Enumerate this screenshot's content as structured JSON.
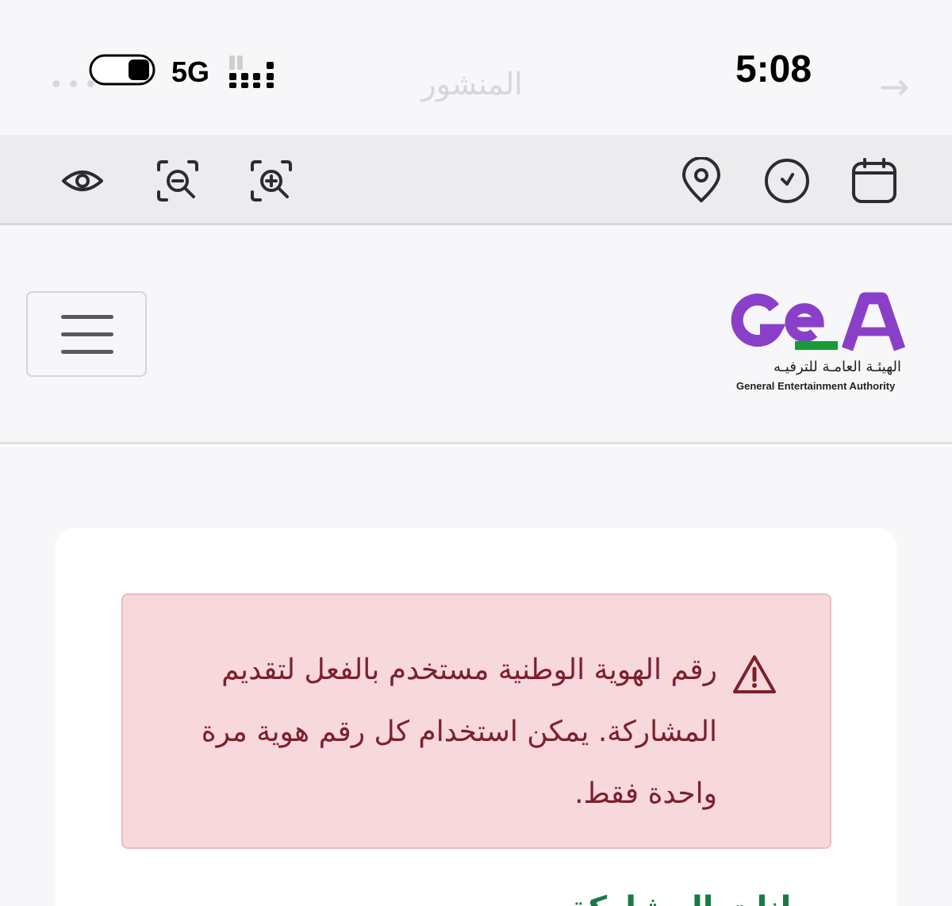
{
  "status_bar": {
    "time": "5:08",
    "network": "5G",
    "background_title": "المنشور",
    "background_more": "•••",
    "background_back": "→"
  },
  "toolbar": {
    "icons": [
      "eye-icon",
      "zoom-out-icon",
      "zoom-in-icon",
      "location-pin-icon",
      "clock-icon",
      "calendar-icon"
    ]
  },
  "header": {
    "logo_mark": "GeA",
    "logo_arabic": "الهيئـة العامـة للترفيـه",
    "logo_english": "General Entertainment Authority",
    "colors": {
      "logo_purple": "#8a3fc9",
      "logo_green": "#1a9a3a"
    }
  },
  "alert": {
    "message": "رقم الهوية الوطنية مستخدم بالفعل لتقديم المشاركة. يمكن استخدام كل رقم هوية مرة واحدة فقط.",
    "icon": "warning-triangle-icon",
    "colors": {
      "background": "#f7d8dc",
      "text": "#7d1f2c"
    }
  },
  "below_heading": "بيانات المشاركة"
}
